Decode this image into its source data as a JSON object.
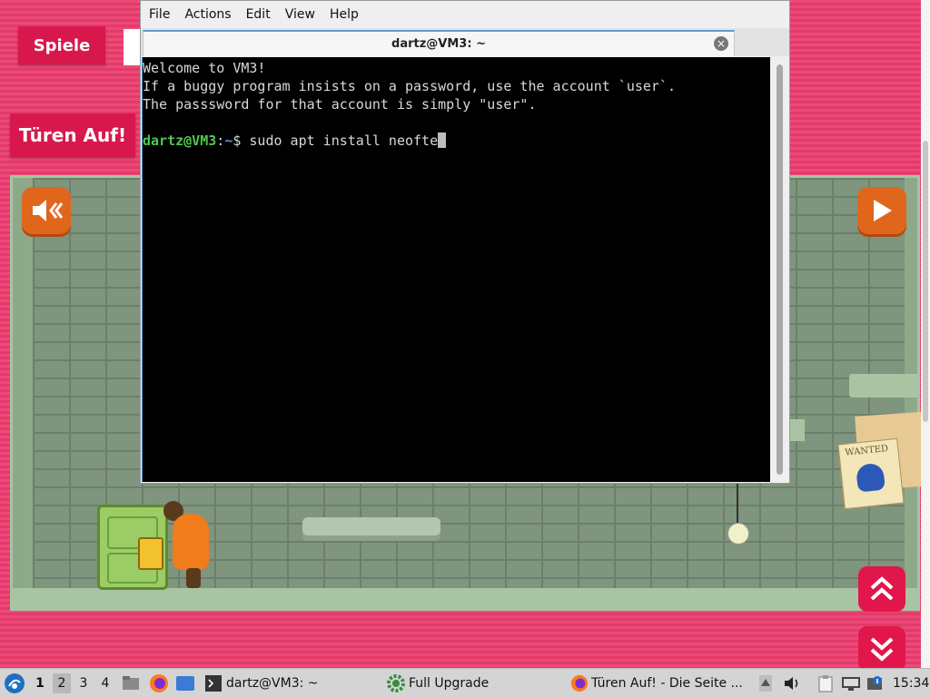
{
  "game": {
    "spiele_label": "Spiele",
    "tueren_label": "Türen Auf!",
    "poster_text": "WANTED"
  },
  "terminal": {
    "menu": [
      "File",
      "Actions",
      "Edit",
      "View",
      "Help"
    ],
    "tab_title": "dartz@VM3: ~",
    "lines": [
      "Welcome to VM3!",
      "If a buggy program insists on a password, use the account `user`.",
      "The passsword for that account is simply \"user\"."
    ],
    "prompt_user": "dartz@VM3",
    "prompt_sep": ":",
    "prompt_path": "~",
    "prompt_symbol": "$ ",
    "command": "sudo apt install neofte"
  },
  "taskbar": {
    "workspaces": [
      "1",
      "2",
      "3",
      "4"
    ],
    "active_workspace": "2",
    "tasks": [
      {
        "label": "dartz@VM3: ~",
        "icon": "terminal-icon"
      },
      {
        "label": "Full Upgrade",
        "icon": "gear-icon"
      },
      {
        "label": "Türen Auf! - Die Seite ...",
        "icon": "firefox-icon"
      }
    ],
    "clock": "15:34"
  },
  "colors": {
    "page_pink": "#e9396b",
    "game_button_orange": "#e0661c",
    "prompt_green": "#4ec94e",
    "prompt_blue": "#5c8fdc"
  }
}
